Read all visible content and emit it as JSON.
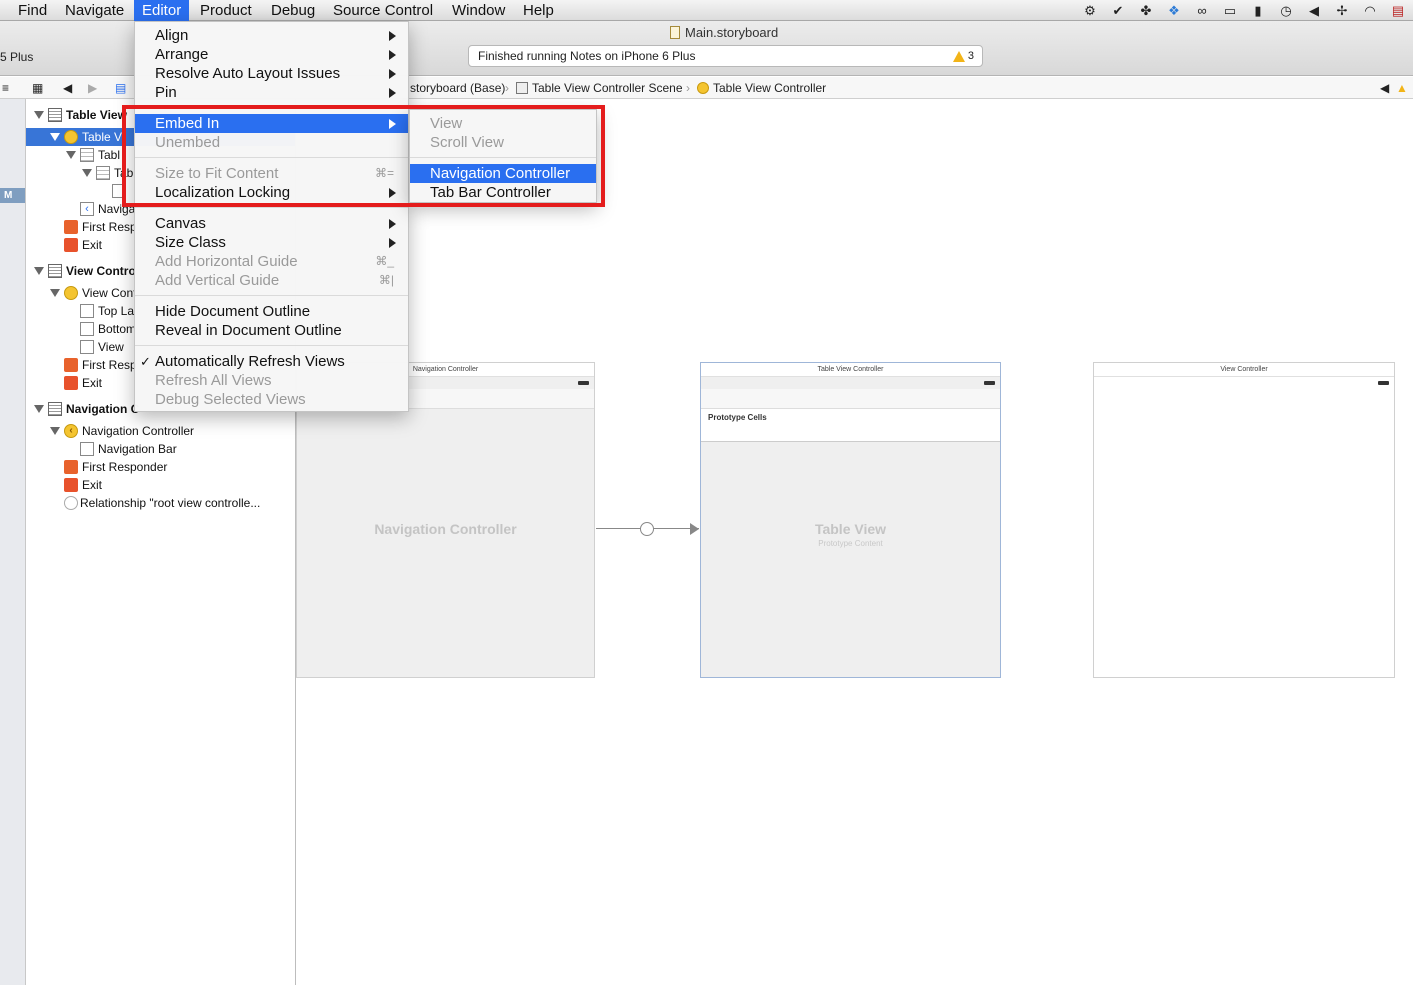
{
  "menubar": {
    "items": [
      "Find",
      "Navigate",
      "Editor",
      "Product",
      "Debug",
      "Source Control",
      "Window",
      "Help"
    ],
    "active": "Editor",
    "status_icons": [
      "gear-icon",
      "check-shield-icon",
      "puzzle-icon",
      "dropbox-icon",
      "infinity-icon",
      "airplay-icon",
      "battery-icon",
      "time-machine-icon",
      "volume-icon",
      "bluetooth-icon",
      "wifi-icon",
      "flag-icon"
    ]
  },
  "toolbar": {
    "window_title": "Main.storyboard",
    "device_partial": "5 Plus",
    "activity_text": "Finished running Notes on iPhone 6 Plus",
    "warning_count": "3"
  },
  "jumpbar": {
    "crumbs": [
      "storyboard (Base)",
      "Table View Controller Scene",
      "Table View Controller"
    ]
  },
  "gutter": {
    "marker": "M"
  },
  "outline": {
    "rows": [
      {
        "label": "Table View",
        "icon": "scene"
      },
      {
        "label": "Table Vi",
        "icon": "vc"
      },
      {
        "label": "Tabl",
        "icon": "tv"
      },
      {
        "label": "Tab",
        "icon": "tv"
      },
      {
        "label": "",
        "icon": "view"
      },
      {
        "label": "Naviga",
        "icon": "nav"
      },
      {
        "label": "First Resp",
        "icon": "fr"
      },
      {
        "label": "Exit",
        "icon": "exit"
      },
      {
        "label": "View Contro",
        "icon": "scene"
      },
      {
        "label": "View Cont",
        "icon": "vc"
      },
      {
        "label": "Top La",
        "icon": "view"
      },
      {
        "label": "Bottom",
        "icon": "view"
      },
      {
        "label": "View",
        "icon": "view"
      },
      {
        "label": "First Resp",
        "icon": "fr"
      },
      {
        "label": "Exit",
        "icon": "exit"
      },
      {
        "label": "Navigation C",
        "icon": "scene"
      },
      {
        "label": "Navigation Controller",
        "icon": "navc"
      },
      {
        "label": "Navigation Bar",
        "icon": "view"
      },
      {
        "label": "First Responder",
        "icon": "fr"
      },
      {
        "label": "Exit",
        "icon": "exit"
      },
      {
        "label": "Relationship \"root view controlle...",
        "icon": "rel"
      }
    ]
  },
  "canvas": {
    "nav_scene_title": "Navigation Controller",
    "nav_scene_body": "Navigation Controller",
    "table_scene_title": "Table View Controller",
    "table_prototype": "Prototype Cells",
    "table_body": "Table View",
    "table_body_sub": "Prototype Content",
    "vc_scene_title": "View Controller"
  },
  "editor_menu": {
    "items": [
      {
        "label": "Align",
        "submenu": true
      },
      {
        "label": "Arrange",
        "submenu": true
      },
      {
        "label": "Resolve Auto Layout Issues",
        "submenu": true
      },
      {
        "label": "Pin",
        "submenu": true
      },
      {
        "label": "Embed In",
        "submenu": true,
        "highlighted": true
      },
      {
        "label": "Unembed",
        "disabled": true
      },
      {
        "label": "Size to Fit Content",
        "disabled": true,
        "shortcut": "⌘="
      },
      {
        "label": "Localization Locking",
        "submenu": true
      },
      {
        "label": "Canvas",
        "submenu": true
      },
      {
        "label": "Size Class",
        "submenu": true
      },
      {
        "label": "Add Horizontal Guide",
        "disabled": true,
        "shortcut": "⌘_"
      },
      {
        "label": "Add Vertical Guide",
        "disabled": true,
        "shortcut": "⌘|"
      },
      {
        "label": "Hide Document Outline"
      },
      {
        "label": "Reveal in Document Outline"
      },
      {
        "label": "Automatically Refresh Views",
        "checked": true
      },
      {
        "label": "Refresh All Views",
        "disabled": true
      },
      {
        "label": "Debug Selected Views",
        "disabled": true
      }
    ]
  },
  "embed_submenu": {
    "items": [
      {
        "label": "View",
        "disabled": true
      },
      {
        "label": "Scroll View",
        "disabled": true
      },
      {
        "label": "Navigation Controller",
        "highlighted": true
      },
      {
        "label": "Tab Bar Controller"
      }
    ]
  },
  "colors": {
    "highlight": "#2a6ff0",
    "annotation_box": "#e41c1c",
    "selection": "#3875d7"
  }
}
